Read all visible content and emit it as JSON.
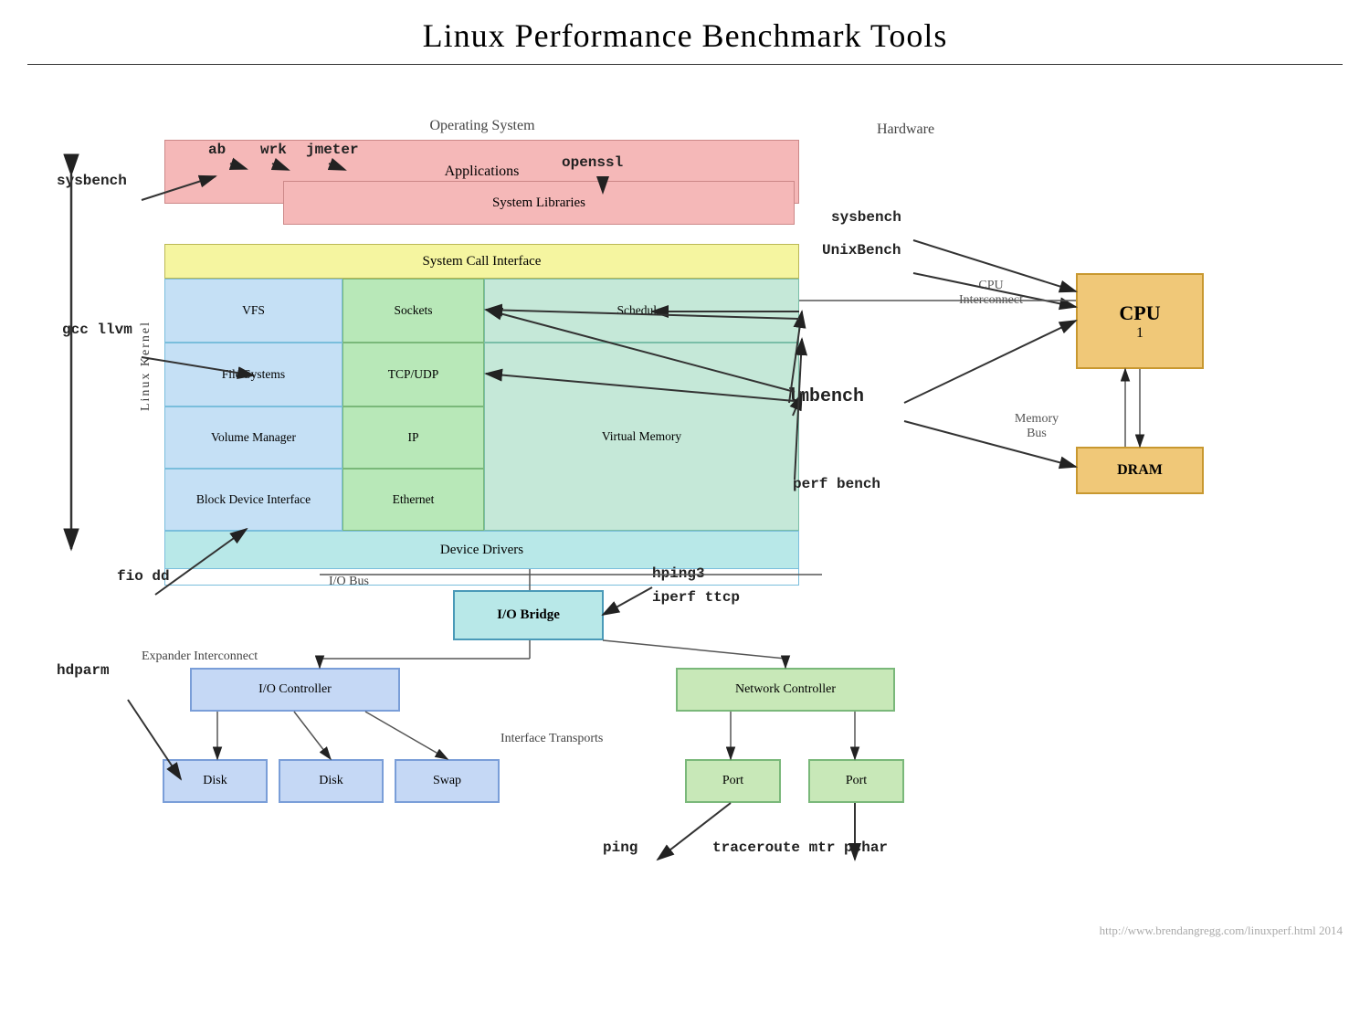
{
  "title": "Linux Performance Benchmark Tools",
  "labels": {
    "os": "Operating System",
    "hardware": "Hardware",
    "applications": "Applications",
    "system_libraries": "System Libraries",
    "syscall_interface": "System Call Interface",
    "linux_kernel": "Linux Kernel",
    "vfs": "VFS",
    "file_systems": "File Systems",
    "volume_manager": "Volume Manager",
    "block_device": "Block Device Interface",
    "sockets": "Sockets",
    "tcp_udp": "TCP/UDP",
    "ip": "IP",
    "ethernet": "Ethernet",
    "scheduler": "Scheduler",
    "virtual_memory": "Virtual Memory",
    "device_drivers": "Device Drivers",
    "io_bus": "I/O Bus",
    "io_bridge": "I/O Bridge",
    "expander_interconnect": "Expander Interconnect",
    "io_controller": "I/O Controller",
    "disk1": "Disk",
    "disk2": "Disk",
    "swap": "Swap",
    "interface_transports": "Interface Transports",
    "net_controller": "Network Controller",
    "port1": "Port",
    "port2": "Port",
    "cpu": "CPU",
    "cpu_num": "1",
    "cpu_interconnect": "CPU\nInterconnect",
    "memory_bus": "Memory\nBus",
    "dram": "DRAM",
    "footer": "http://www.brendangregg.com/linuxperf.html 2014"
  },
  "tools": {
    "sysbench_left": "sysbench",
    "ab": "ab",
    "wrk": "wrk",
    "jmeter": "jmeter",
    "openssl": "openssl",
    "gcc_llvm": "gcc\nllvm",
    "fio_dd": "fio\ndd",
    "hdparm": "hdparm",
    "sysbench_right": "sysbench",
    "unixbench": "UnixBench",
    "lmbench": "lmbench",
    "perf_bench": "perf bench",
    "hping3": "hping3",
    "iperf_ttcp": "iperf  ttcp",
    "ping": "ping",
    "traceroute": "traceroute  mtr  pchar"
  }
}
